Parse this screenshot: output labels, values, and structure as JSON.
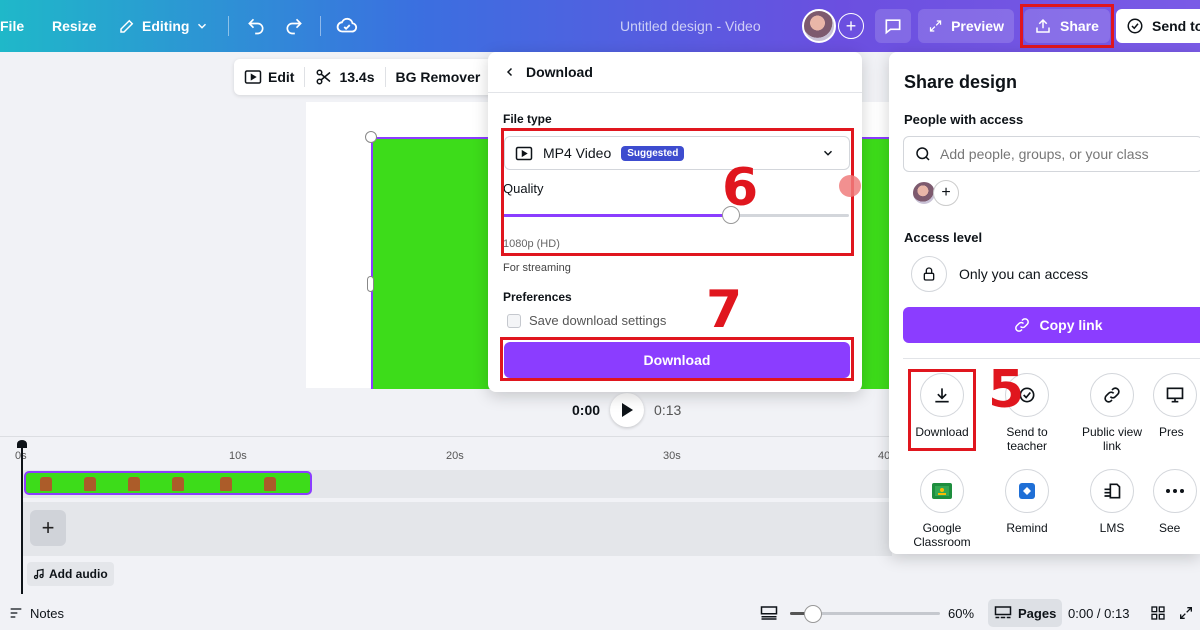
{
  "topbar": {
    "file": "File",
    "resize": "Resize",
    "editing": "Editing",
    "title": "Untitled design - Video",
    "preview": "Preview",
    "share": "Share",
    "send_to": "Send to"
  },
  "context_toolbar": {
    "edit": "Edit",
    "duration": "13.4s",
    "bg_remover": "BG Remover"
  },
  "playback": {
    "current": "0:00",
    "total": "0:13"
  },
  "timeline": {
    "ruler": [
      "0s",
      "10s",
      "20s",
      "30s",
      "40"
    ],
    "add_audio": "Add audio"
  },
  "bottombar": {
    "notes": "Notes",
    "zoom": "60%",
    "zoom_level": 0.6,
    "pages": "Pages",
    "time": "0:00 / 0:13"
  },
  "download_panel": {
    "title": "Download",
    "file_type_label": "File type",
    "file_type": "MP4 Video",
    "suggested": "Suggested",
    "quality_label": "Quality",
    "quality_level": 0.66,
    "resolution": "1080p (HD)",
    "streaming": "For streaming",
    "preferences_label": "Preferences",
    "save_settings": "Save download settings",
    "download_button": "Download"
  },
  "share_panel": {
    "title": "Share design",
    "people_label": "People with access",
    "search_placeholder": "Add people, groups, or your class",
    "access_label": "Access level",
    "access_value": "Only you can access",
    "copy_link": "Copy link",
    "options": {
      "download": "Download",
      "send_teacher": "Send to teacher",
      "public_view": "Public view link",
      "present": "Pres",
      "google_classroom": "Google Classroom",
      "remind": "Remind",
      "lms": "LMS",
      "see_all": "See"
    }
  },
  "annotations": {
    "step5": "5",
    "step6": "6",
    "step7": "7"
  },
  "colors": {
    "accent": "#8b3dff",
    "highlight": "#e0161e",
    "clip_green": "#3ddc1a"
  }
}
